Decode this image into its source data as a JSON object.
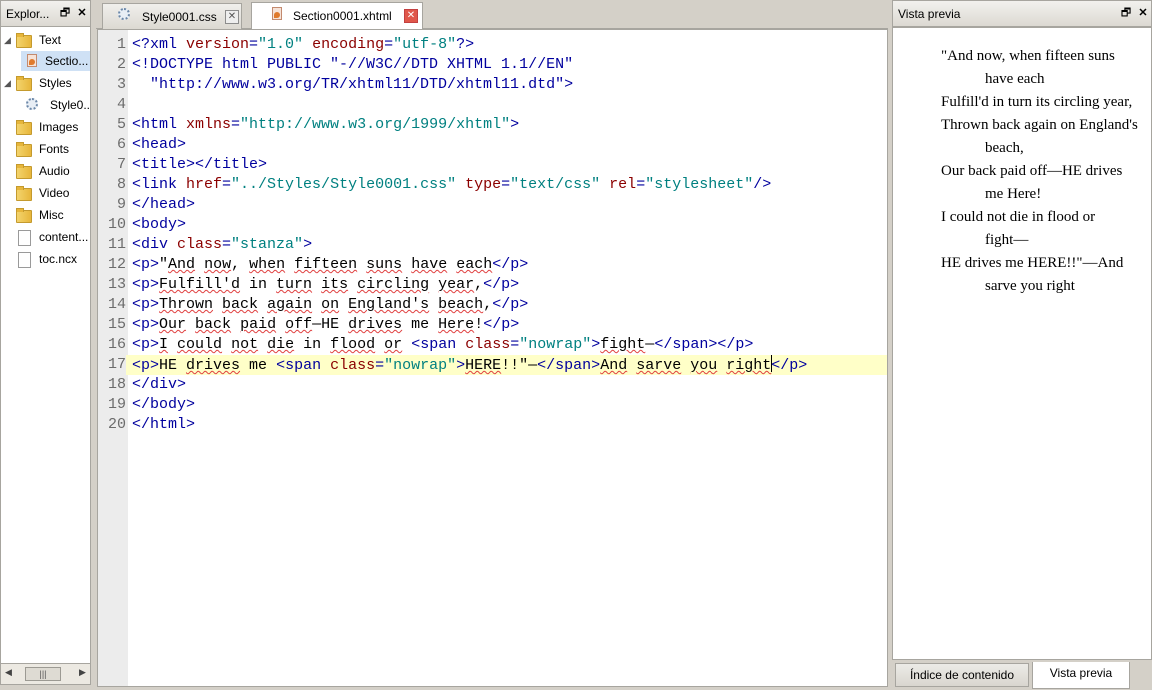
{
  "explorer": {
    "title": "Explor...",
    "items": [
      {
        "label": "Text",
        "kind": "folder"
      },
      {
        "label": "Sectio...",
        "kind": "xhtml-file"
      },
      {
        "label": "Styles",
        "kind": "folder"
      },
      {
        "label": "Style0...",
        "kind": "css-file"
      },
      {
        "label": "Images",
        "kind": "folder"
      },
      {
        "label": "Fonts",
        "kind": "folder"
      },
      {
        "label": "Audio",
        "kind": "folder"
      },
      {
        "label": "Video",
        "kind": "folder"
      },
      {
        "label": "Misc",
        "kind": "folder"
      },
      {
        "label": "content...",
        "kind": "file"
      },
      {
        "label": "toc.ncx",
        "kind": "file"
      }
    ]
  },
  "editor": {
    "tabs": [
      {
        "label": "Style0001.css",
        "active": false
      },
      {
        "label": "Section0001.xhtml",
        "active": true
      }
    ],
    "line_numbers": [
      "1",
      "2",
      "3",
      "4",
      "5",
      "6",
      "7",
      "8",
      "9",
      "10",
      "11",
      "12",
      "13",
      "14",
      "15",
      "16",
      "17",
      "18",
      "19",
      "20"
    ],
    "current_line": 17,
    "code": [
      "<?xml version=\"1.0\" encoding=\"utf-8\"?>",
      "<!DOCTYPE html PUBLIC \"-//W3C//DTD XHTML 1.1//EN\"",
      "  \"http://www.w3.org/TR/xhtml11/DTD/xhtml11.dtd\">",
      "",
      "<html xmlns=\"http://www.w3.org/1999/xhtml\">",
      "<head>",
      "<title></title>",
      "<link href=\"../Styles/Style0001.css\" type=\"text/css\" rel=\"stylesheet\"/>",
      "</head>",
      "<body>",
      "<div class=\"stanza\">",
      "<p>\"And now, when fifteen suns have each</p>",
      "<p>Fulfill'd in turn its circling year,</p>",
      "<p>Thrown back again on England's beach,</p>",
      "<p>Our back paid off—HE drives me Here!</p>",
      "<p>I could not die in flood or <span class=\"nowrap\">fight—</span></p>",
      "<p>HE drives me <span class=\"nowrap\">HERE!!\"—</span>And sarve you right</p>",
      "</div>",
      "</body>",
      "</html>"
    ]
  },
  "preview": {
    "title": "Vista previa",
    "stanza": [
      {
        "text": "\"And now, when fifteen suns have each",
        "nowrap": ""
      },
      {
        "text": "Fulfill'd in turn its circling year,",
        "nowrap": ""
      },
      {
        "text": "Thrown back again on England's beach,",
        "nowrap": ""
      },
      {
        "text": "Our back paid off—HE drives me Here!",
        "nowrap": ""
      },
      {
        "text": "I could not die in flood or ",
        "nowrap": "fight—"
      },
      {
        "text": "HE drives me ",
        "nowrap": "HERE!!\"—",
        "after": "And sarve you right"
      }
    ],
    "bottom_tabs": [
      {
        "label": "Índice de contenido",
        "active": false
      },
      {
        "label": "Vista previa",
        "active": true
      }
    ]
  },
  "colors": {
    "tag": "#00009e",
    "attribute": "#8b0000",
    "value": "#008080",
    "current_line_bg": "#ffffc8",
    "gutter_bg": "#ececec"
  }
}
